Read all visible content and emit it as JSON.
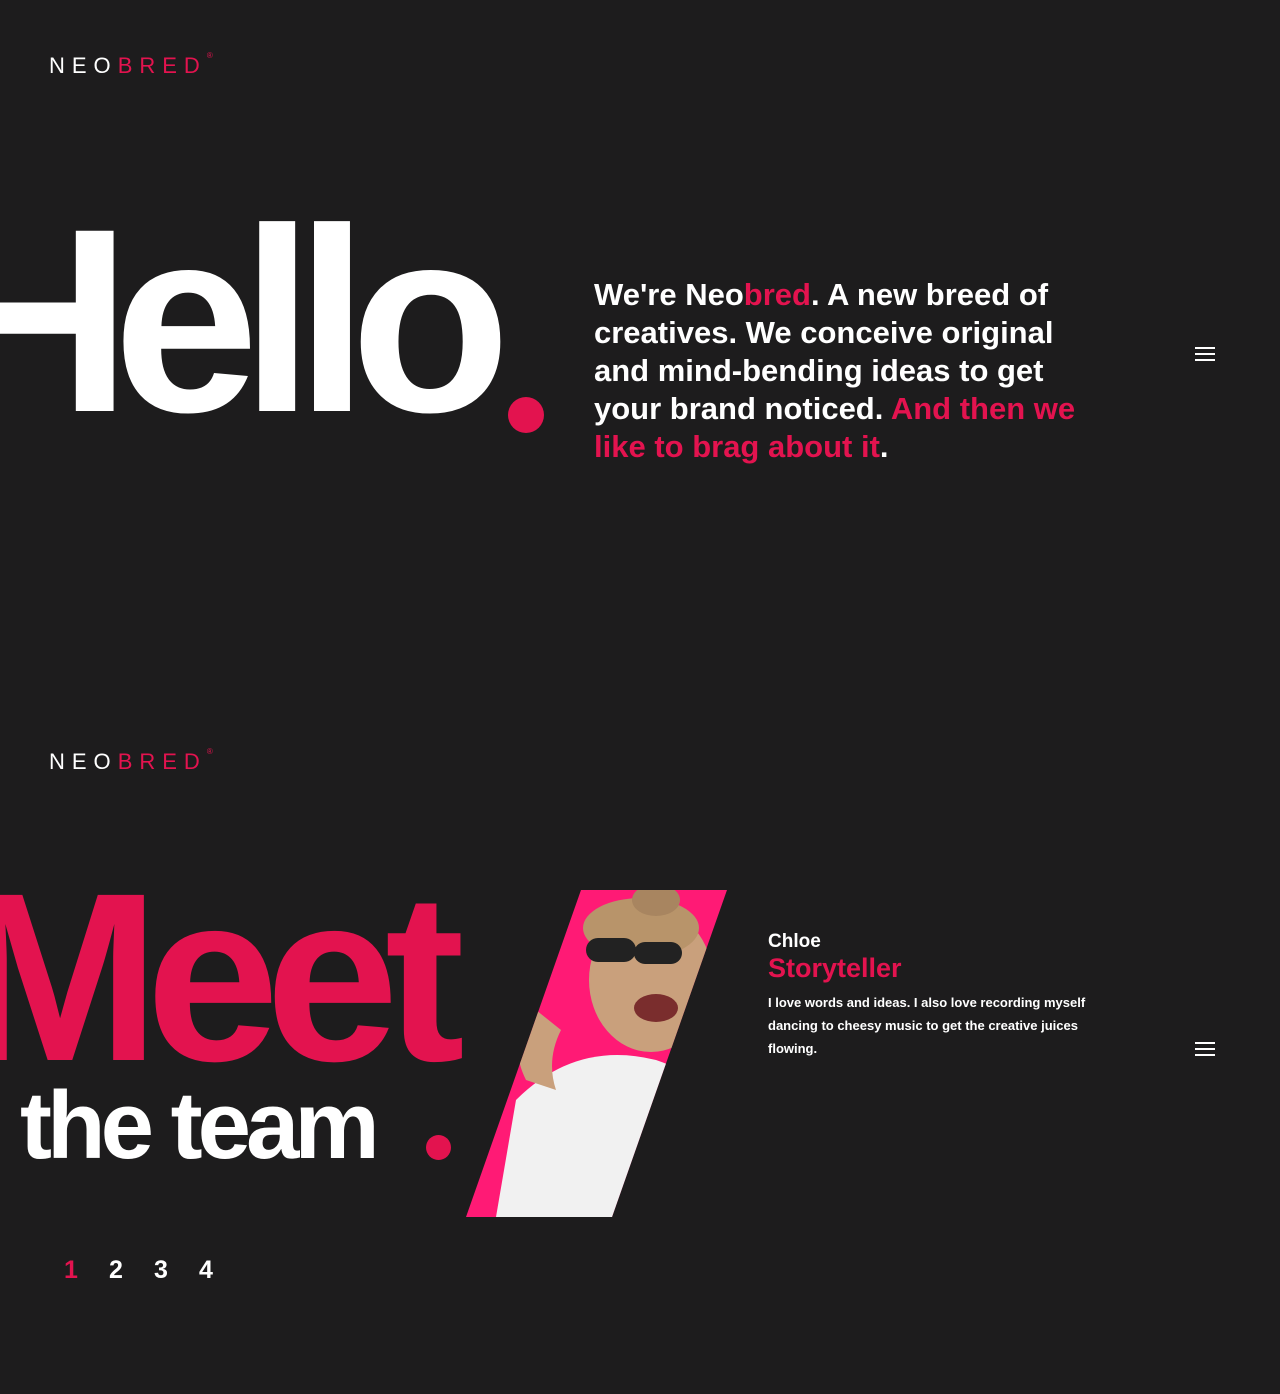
{
  "brand": {
    "logo_neo": "NEO",
    "logo_bred": "BRED",
    "logo_reg": "®"
  },
  "colors": {
    "background": "#1d1c1d",
    "accent": "#e3134f",
    "text": "#ffffff"
  },
  "hero": {
    "big_word": "Hello",
    "intro": {
      "part1": "We're Neo",
      "brand_accent": "bred",
      "part2": ". A new breed of creatives. We conceive original and mind-bending ideas to get your brand noticed. ",
      "accent_sentence": "And then we like to brag about it",
      "end": "."
    },
    "menu_icon": "hamburger-icon"
  },
  "team": {
    "big_word": "Meet",
    "sub_word": "the team",
    "menu_icon": "hamburger-icon",
    "member": {
      "name": "Chloe",
      "role": "Storyteller",
      "bio": "I love words and ideas. I also love recording myself dancing to cheesy music to get the creative juices flowing.",
      "photo_icon": "person-photo"
    },
    "pages": [
      "1",
      "2",
      "3",
      "4"
    ],
    "active_page": "1"
  }
}
